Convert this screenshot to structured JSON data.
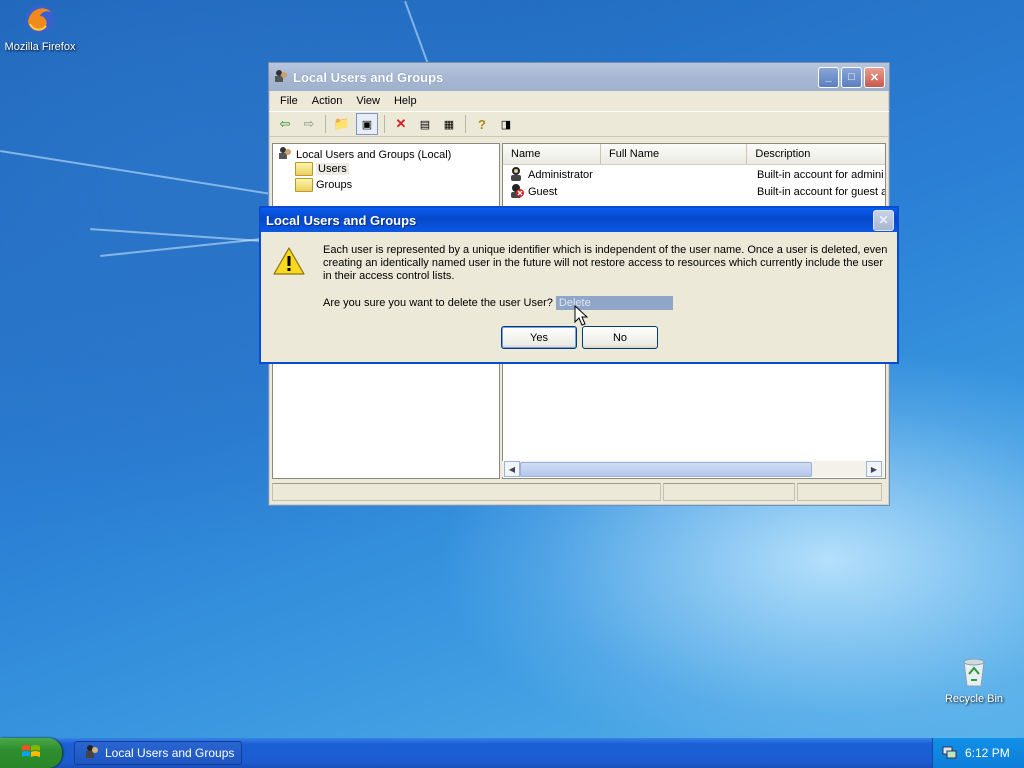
{
  "desktop": {
    "icons": [
      {
        "label": "Mozilla Firefox",
        "icon": "firefox-icon"
      },
      {
        "label": "Recycle Bin",
        "icon": "recycle-bin-icon"
      }
    ]
  },
  "window": {
    "title": "Local Users and Groups",
    "menu": [
      "File",
      "Action",
      "View",
      "Help"
    ],
    "tree": {
      "root": "Local Users and Groups (Local)",
      "children": [
        "Users",
        "Groups"
      ]
    },
    "list": {
      "columns": [
        "Name",
        "Full Name",
        "Description"
      ],
      "rows": [
        {
          "name": "Administrator",
          "full_name": "",
          "description": "Built-in account for admini"
        },
        {
          "name": "Guest",
          "full_name": "",
          "description": "Built-in account for guest a"
        }
      ]
    }
  },
  "dialog": {
    "title": "Local Users and Groups",
    "message": "Each user is represented by a unique identifier which is independent of the user name.  Once a user is deleted, even creating an identically named user in the future will not restore access to resources which currently include the user in their access control lists.",
    "question": "Are you sure you want to delete the user User?",
    "highlight_text": "Delete",
    "yes_label": "Yes",
    "no_label": "No"
  },
  "taskbar": {
    "task_label": "Local Users and Groups",
    "clock": "6:12 PM"
  },
  "colors": {
    "dialog_title": "#0548c8",
    "start_button": "#2e8e2e",
    "taskbar": "#1c5ccf"
  }
}
